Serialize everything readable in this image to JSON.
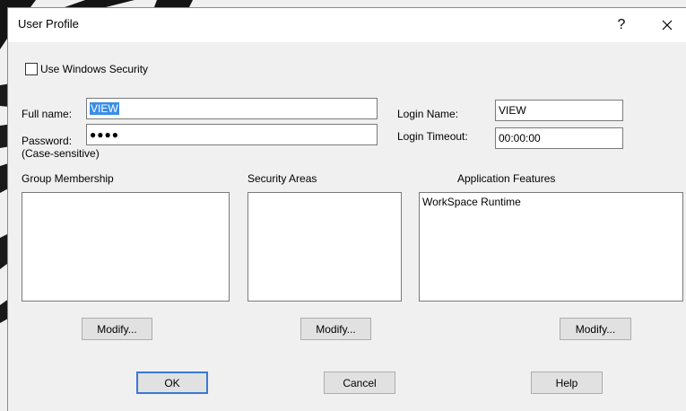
{
  "window": {
    "title": "User Profile",
    "help_glyph": "?",
    "close_glyph": "✕"
  },
  "security": {
    "use_windows_security_label": "Use Windows Security",
    "use_windows_security_checked": false
  },
  "fields": {
    "full_name_label": "Full name:",
    "full_name_value": "VIEW",
    "password_label": "Password:",
    "password_hint": "(Case-sensitive)",
    "password_masked": "●●●●",
    "login_name_label": "Login Name:",
    "login_name_value": "VIEW",
    "login_timeout_label": "Login Timeout:",
    "login_timeout_value": "00:00:00"
  },
  "lists": {
    "group_membership": {
      "label": "Group Membership",
      "items": []
    },
    "security_areas": {
      "label": "Security Areas",
      "items": []
    },
    "application_features": {
      "label": "Application Features",
      "items": [
        "WorkSpace Runtime"
      ]
    }
  },
  "buttons": {
    "modify_label": "Modify...",
    "ok_label": "OK",
    "cancel_label": "Cancel",
    "help_label": "Help"
  },
  "colors": {
    "selection": "#3a8ee6",
    "default_button_border": "#3a78d4",
    "window_bg": "#f0f0f0"
  }
}
